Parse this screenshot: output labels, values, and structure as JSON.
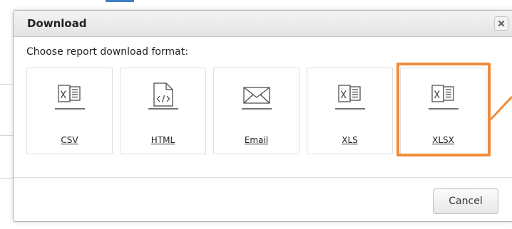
{
  "dialog": {
    "title": "Download",
    "close_icon": "close-icon",
    "prompt": "Choose report download format:",
    "formats": [
      {
        "label": "CSV",
        "icon": "spreadsheet-icon"
      },
      {
        "label": "HTML",
        "icon": "html-file-icon"
      },
      {
        "label": "Email",
        "icon": "envelope-icon"
      },
      {
        "label": "XLS",
        "icon": "spreadsheet-icon"
      },
      {
        "label": "XLSX",
        "icon": "spreadsheet-icon"
      }
    ],
    "cancel_label": "Cancel",
    "highlight_color": "#f08b3a"
  }
}
